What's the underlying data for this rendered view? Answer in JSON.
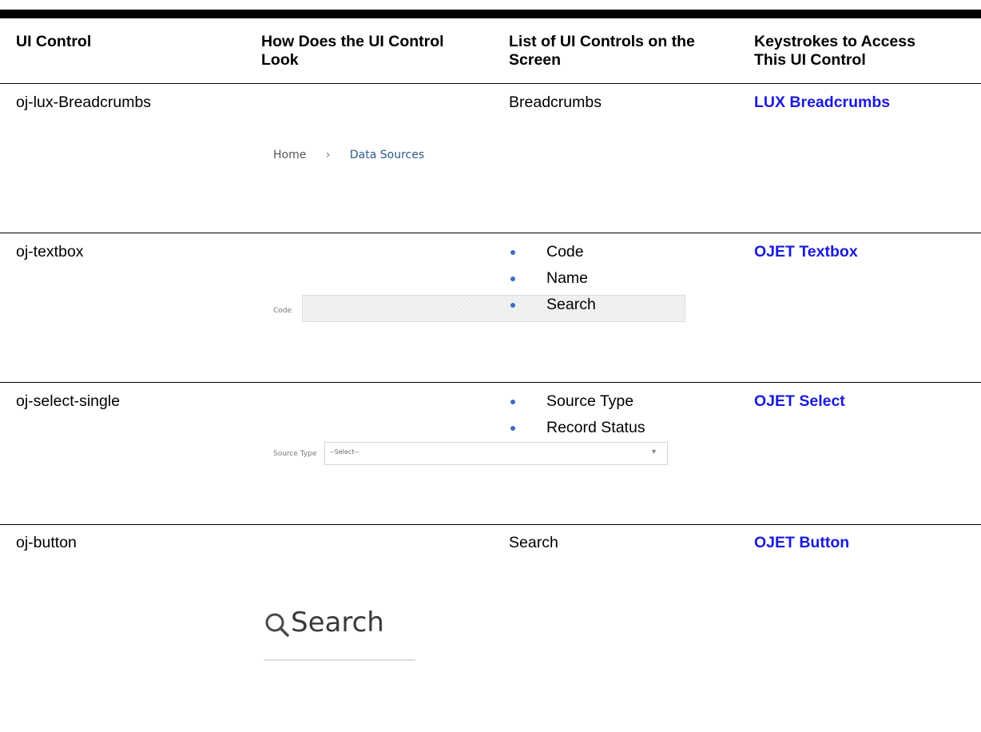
{
  "headers": {
    "col1": "UI Control",
    "col2_line1": "How Does the UI Control",
    "col2_line2": "Look",
    "col3_line1": "List of UI Controls on the",
    "col3_line2": "Screen",
    "col4_line1": "Keystrokes to Access",
    "col4_line2": "This UI Control"
  },
  "rows": [
    {
      "control": "oj-lux-Breadcrumbs",
      "list_text": "Breadcrumbs",
      "link": "LUX Breadcrumbs",
      "preview": {
        "home": "Home",
        "sep": "›",
        "current": "Data Sources"
      }
    },
    {
      "control": "oj-textbox",
      "list": [
        "Code",
        "Name",
        "Search"
      ],
      "link": "OJET Textbox",
      "preview": {
        "label": "Code"
      }
    },
    {
      "control": "oj-select-single",
      "list": [
        "Source Type",
        "Record Status"
      ],
      "link": "OJET Select",
      "preview": {
        "label": "Source Type",
        "value": "--Select--",
        "caret": "▼"
      }
    },
    {
      "control": "oj-button",
      "list_text": "Search",
      "link": "OJET Button",
      "preview": {
        "label": "Search",
        "icon": "search-icon"
      }
    }
  ],
  "colors": {
    "link": "#1a1adb",
    "bullet": "#3a6ec6",
    "rule": "#000000"
  }
}
